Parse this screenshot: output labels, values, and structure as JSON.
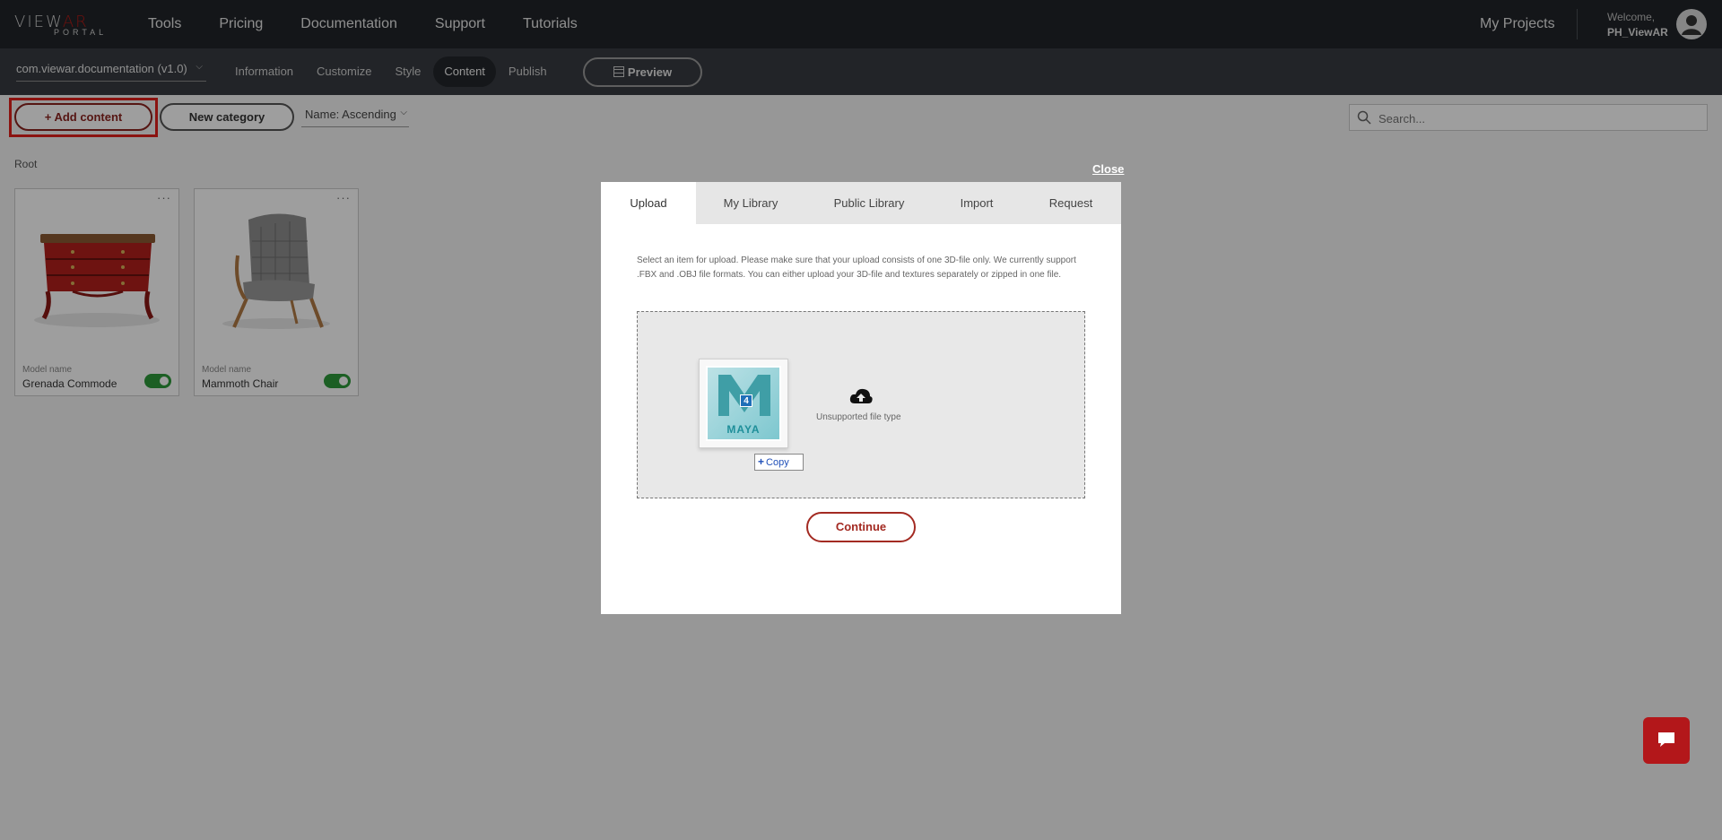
{
  "topbar": {
    "logo_main": "VIEW",
    "logo_accent": "AR",
    "logo_sub": "PORTAL",
    "nav": [
      "Tools",
      "Pricing",
      "Documentation",
      "Support",
      "Tutorials"
    ],
    "my_projects": "My Projects",
    "welcome": "Welcome,",
    "user": "PH_ViewAR"
  },
  "subbar": {
    "project": "com.viewar.documentation (v1.0)",
    "tabs": [
      "Information",
      "Customize",
      "Style",
      "Content",
      "Publish"
    ],
    "active_tab": "Content",
    "preview": "Preview"
  },
  "toolbar": {
    "add_content": "+ Add content",
    "new_category": "New category",
    "sort": "Name: Ascending",
    "search_placeholder": "Search..."
  },
  "content": {
    "breadcrumb": "Root",
    "cards": [
      {
        "label": "Model name",
        "name": "Grenada Commode",
        "enabled": true
      },
      {
        "label": "Model name",
        "name": "Mammoth Chair",
        "enabled": true
      }
    ]
  },
  "modal": {
    "close": "Close",
    "tabs": [
      "Upload",
      "My Library",
      "Public Library",
      "Import",
      "Request"
    ],
    "active_tab": "Upload",
    "instructions": "Select an item for upload. Please make sure that your upload consists of one 3D-file only. We currently support .FBX and .OBJ file formats. You can either upload your 3D-file and textures separately or zipped in one file.",
    "file_badge": "4",
    "file_label": "MAYA",
    "copy_tag": "Copy",
    "status": "Unsupported file type",
    "continue": "Continue"
  },
  "colors": {
    "topbar": "#212529",
    "subbar": "#373b41",
    "accent": "#a32a22",
    "toggle_on": "#2e9a3a",
    "chat": "#b3171a"
  }
}
